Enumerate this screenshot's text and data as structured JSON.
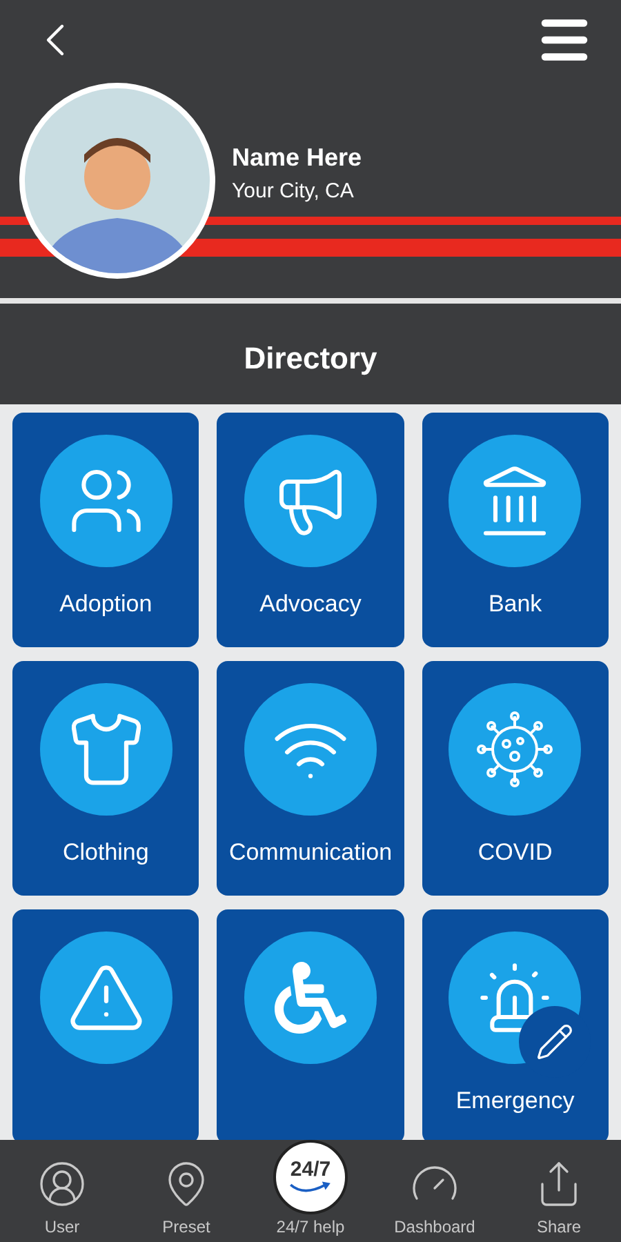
{
  "profile": {
    "name": "Name Here",
    "location": "Your City, CA"
  },
  "section_title": "Directory",
  "tiles": [
    {
      "kind": "family",
      "label": "Adoption"
    },
    {
      "kind": "megaphone",
      "label": "Advocacy"
    },
    {
      "kind": "bank",
      "label": "Bank"
    },
    {
      "kind": "shirt",
      "label": "Clothing"
    },
    {
      "kind": "wifi",
      "label": "Communication"
    },
    {
      "kind": "virus",
      "label": "COVID"
    },
    {
      "kind": "warning"
    },
    {
      "kind": "wheelchair"
    },
    {
      "kind": "siren",
      "label": "Emergency"
    }
  ],
  "nav": [
    {
      "label": "User"
    },
    {
      "label": "Preset"
    },
    {
      "label": "24/7 help"
    },
    {
      "label": "Dashboard"
    },
    {
      "label": "Share"
    }
  ],
  "help_badge": "24/7"
}
